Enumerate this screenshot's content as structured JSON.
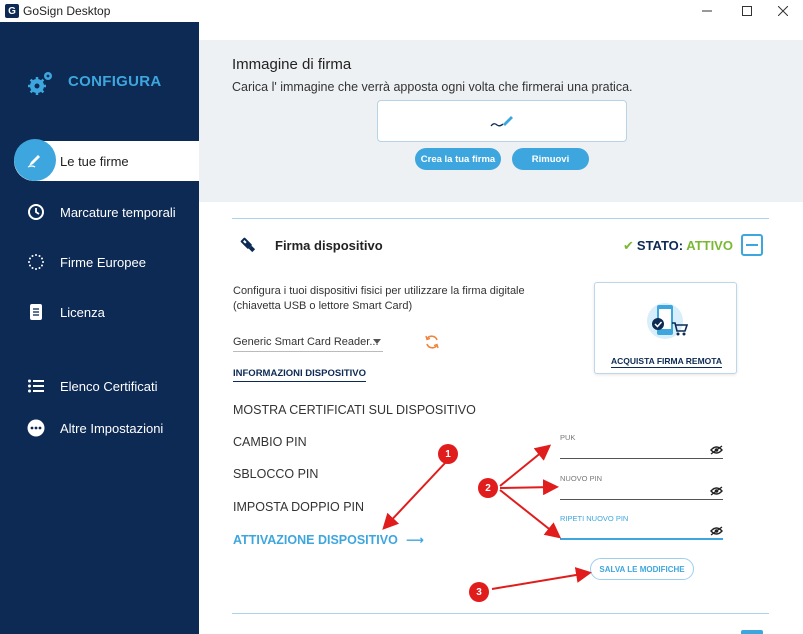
{
  "window": {
    "title": "GoSign Desktop",
    "app_icon_letter": "G"
  },
  "sidebar": {
    "brand": "CONFIGURA",
    "items": [
      {
        "label": "Le tue firme",
        "icon": "signature-icon",
        "active": true
      },
      {
        "label": "Marcature temporali",
        "icon": "clock-icon"
      },
      {
        "label": "Firme Europee",
        "icon": "eu-stars-icon"
      },
      {
        "label": "Licenza",
        "icon": "license-icon"
      },
      {
        "label": "Elenco Certificati",
        "icon": "list-icon"
      },
      {
        "label": "Altre Impostazioni",
        "icon": "more-icon"
      }
    ]
  },
  "signature_image": {
    "title": "Immagine di firma",
    "description": "Carica l' immagine che verrà apposta ogni volta che firmerai una pratica.",
    "create_button": "Crea la tua firma",
    "remove_button": "Rimuovi"
  },
  "device_signature": {
    "title": "Firma dispositivo",
    "status_label": "STATO:",
    "status_value": "ATTIVO",
    "status_color": "#7ab833",
    "description": "Configura i tuoi dispositivi fisici per utilizzare la firma digitale (chiavetta USB o lettore Smart Card)",
    "reader_selected": "Generic Smart Card Reader...",
    "info_link": "INFORMAZIONI DISPOSITIVO",
    "remote_card_label": "ACQUISTA FIRMA REMOTA",
    "menu": [
      "MOSTRA CERTIFICATI SUL DISPOSITIVO",
      "CAMBIO PIN",
      "SBLOCCO PIN",
      "IMPOSTA DOPPIO PIN",
      "ATTIVAZIONE DISPOSITIVO"
    ],
    "fields": {
      "puk_label": "PUK",
      "new_pin_label": "NUOVO PIN",
      "repeat_pin_label": "RIPETI NUOVO PIN"
    },
    "save_button": "SALVA LE MODIFICHE"
  },
  "annotations": {
    "badge1": "1",
    "badge2": "2",
    "badge3": "3",
    "color": "#e01c1c"
  },
  "colors": {
    "sidebar": "#0c2a54",
    "accent": "#3ea6de",
    "panel_bg": "#eef1f4"
  }
}
